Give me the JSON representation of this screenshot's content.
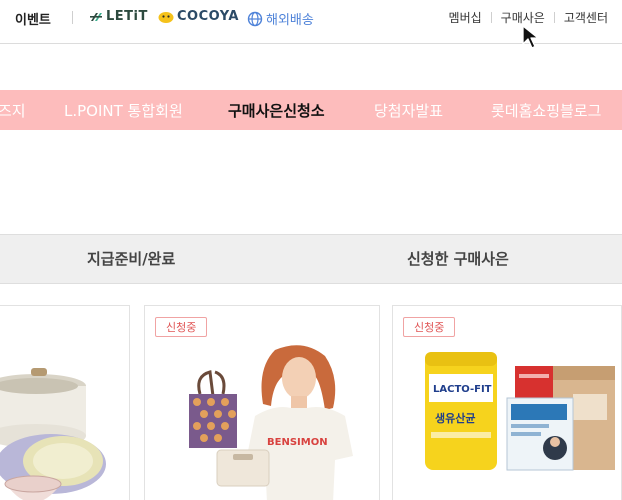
{
  "topbar": {
    "event_label": "이벤트",
    "brands": {
      "letit": "LETiT",
      "cocoya": "COCOYA",
      "overseas": "해외배송"
    },
    "util_links": [
      "멤버십",
      "구매사은",
      "고객센터"
    ]
  },
  "nav": {
    "items": [
      "즈지",
      "L.POINT 통합회원",
      "구매사은신청소",
      "당첨자발표",
      "롯데홈쇼핑블로그"
    ],
    "active_index": 2
  },
  "tabs": [
    "지급준비/완료",
    "신청한 구매사은"
  ],
  "products": [
    {
      "badge": "",
      "icon": "cookware-icon"
    },
    {
      "badge": "신청중",
      "icon": "fashion-model-icon",
      "shirt_text": "BENSIMON"
    },
    {
      "badge": "신청중",
      "icon": "probiotics-icon",
      "product_text": "LACTO-FIT",
      "product_sub": "생유산균"
    }
  ],
  "colors": {
    "nav_bg": "#fdbcbc",
    "badge": "#e05555",
    "overseas": "#4f83d9"
  }
}
